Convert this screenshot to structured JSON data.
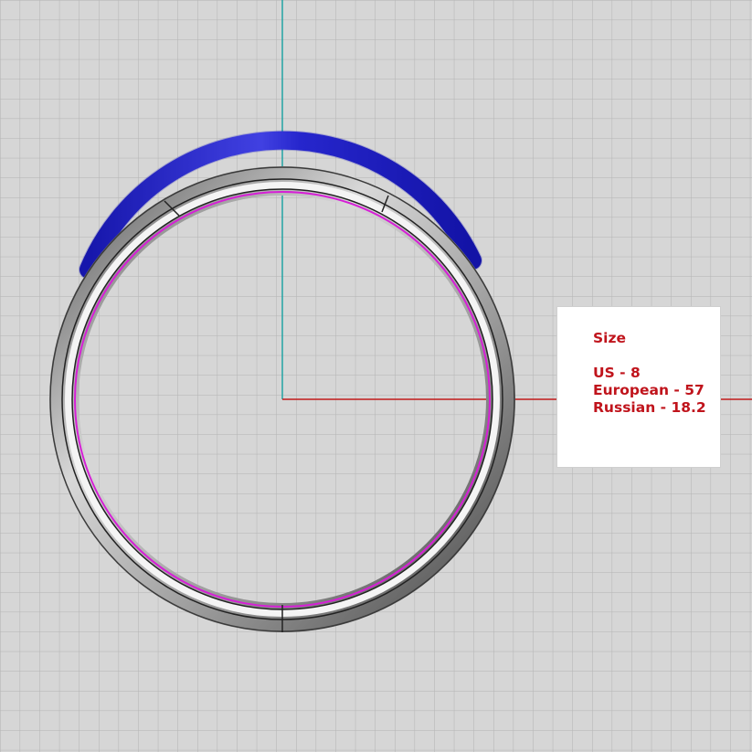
{
  "viewport": {
    "background": "#d6d6d6",
    "grid_color": "#b3b3b3",
    "x_axis_color": "#c21a1a",
    "y_axis_color": "#22a3a3"
  },
  "ring": {
    "band_color": "#8a8a8a",
    "inner_edge_color": "#d61fd6",
    "accent_arc_color": "#2121c4"
  },
  "size_panel": {
    "title": "Size",
    "us": "US - 8",
    "european": "European - 57",
    "russian": "Russian - 18.2",
    "text_color": "#c0141c"
  }
}
